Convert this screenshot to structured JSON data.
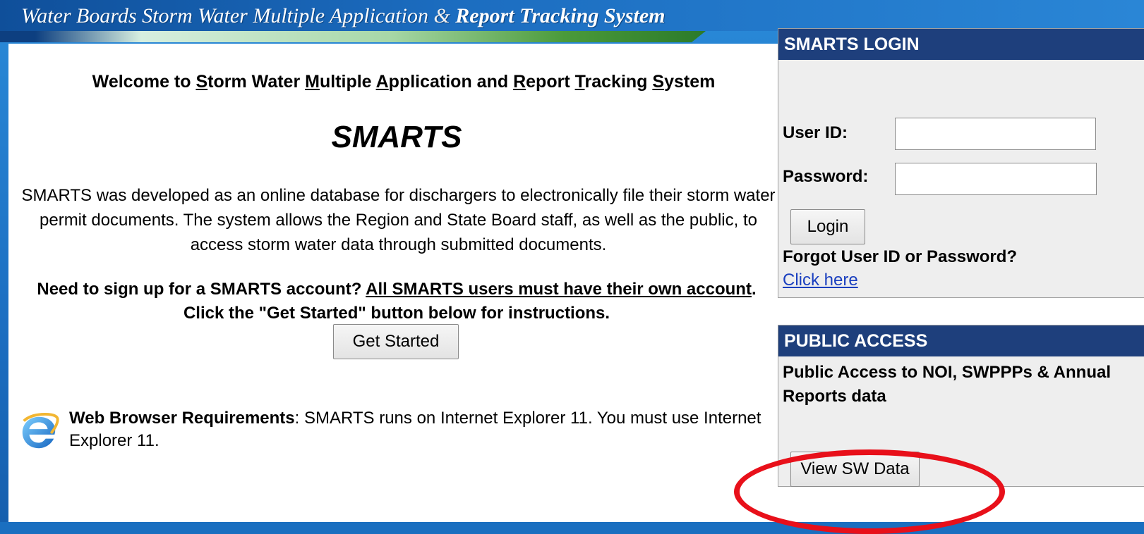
{
  "banner": {
    "part1": "Water Boards  Storm Water Multiple Application",
    "amp": " & ",
    "part2": "Report Tracking System"
  },
  "welcome": {
    "prefix": "Welcome to ",
    "w1_first": "S",
    "w1_rest": "torm Water ",
    "w2_first": "M",
    "w2_rest": "ultiple ",
    "w3_first": "A",
    "w3_rest": "pplication and ",
    "w4_first": "R",
    "w4_rest": "eport ",
    "w5_first": "T",
    "w5_rest": "racking ",
    "w6_first": "S",
    "w6_rest": "ystem"
  },
  "title": "SMARTS",
  "description": "SMARTS was developed as an online database for dischargers to electronically file their storm water permit documents. The system allows the Region and State Board staff, as well as the public, to access storm water data through submitted documents.",
  "signup": {
    "lead": "Need to sign up for a SMARTS account? ",
    "underlined": "All SMARTS users must have their own account",
    "tail": ". Click the \"Get Started\" button below for instructions."
  },
  "get_started_label": "Get Started",
  "browser": {
    "heading": "Web Browser Requirements",
    "text": ": SMARTS runs on Internet Explorer 11. You must use Internet Explorer 11.",
    "icon": "internet-explorer-icon"
  },
  "login": {
    "header": "SMARTS LOGIN",
    "user_id_label": "User ID:",
    "user_id_value": "",
    "password_label": "Password:",
    "password_value": "",
    "login_label": "Login",
    "forgot_text": "Forgot User ID or Password?",
    "click_here": "Click here"
  },
  "public_access": {
    "header": "PUBLIC ACCESS",
    "text": "Public Access to NOI, SWPPPs & Annual Reports data",
    "button_label": "View SW Data"
  },
  "colors": {
    "background": "#1a6fc0",
    "panel_header": "#1e3f7c",
    "highlight": "#e8101a",
    "link": "#1a3fbf"
  }
}
